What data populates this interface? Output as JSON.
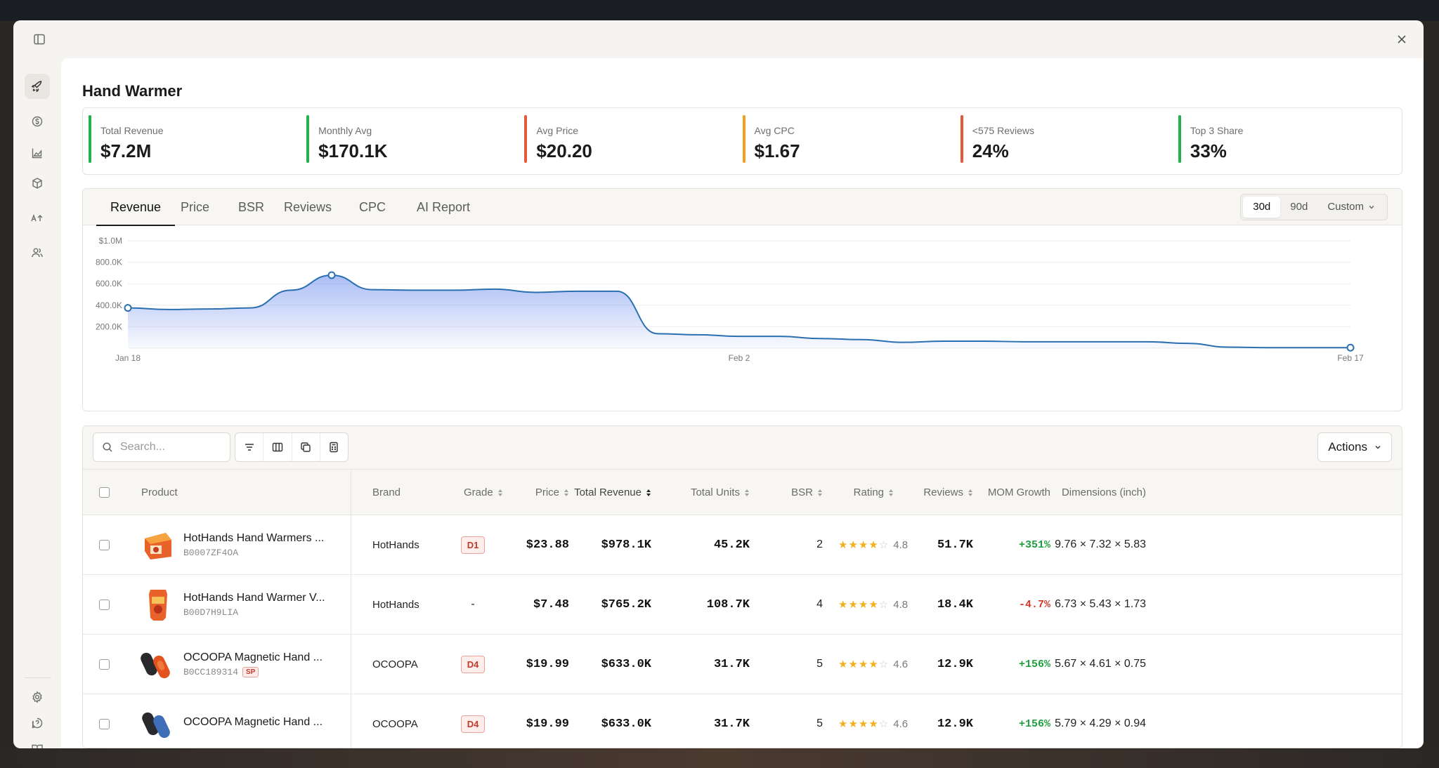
{
  "title": "Hand Warmer",
  "kpis": [
    {
      "label": "Total Revenue",
      "value": "$7.2M",
      "color": "#22b14c"
    },
    {
      "label": "Monthly Avg",
      "value": "$170.1K",
      "color": "#22b14c"
    },
    {
      "label": "Avg Price",
      "value": "$20.20",
      "color": "#e35a3a"
    },
    {
      "label": "Avg CPC",
      "value": "$1.67",
      "color": "#f0a020"
    },
    {
      "label": "<575 Reviews",
      "value": "24%",
      "color": "#e35a3a"
    },
    {
      "label": "Top 3 Share",
      "value": "33%",
      "color": "#22b14c"
    }
  ],
  "tabs": [
    "Revenue",
    "Price",
    "BSR",
    "Reviews",
    "CPC",
    "AI Report"
  ],
  "ranges": {
    "r30": "30d",
    "r90": "90d",
    "custom": "Custom"
  },
  "chart_data": {
    "type": "area",
    "x": [
      "Jan 18",
      "Jan 19",
      "Jan 20",
      "Jan 21",
      "Jan 22",
      "Jan 23",
      "Jan 24",
      "Jan 25",
      "Jan 26",
      "Jan 27",
      "Jan 28",
      "Jan 29",
      "Jan 30",
      "Jan 31",
      "Feb 1",
      "Feb 2",
      "Feb 3",
      "Feb 4",
      "Feb 5",
      "Feb 6",
      "Feb 7",
      "Feb 8",
      "Feb 9",
      "Feb 10",
      "Feb 11",
      "Feb 12",
      "Feb 13",
      "Feb 14",
      "Feb 15",
      "Feb 16",
      "Feb 17"
    ],
    "y": [
      375000,
      360000,
      365000,
      375000,
      540000,
      680000,
      545000,
      540000,
      540000,
      550000,
      520000,
      530000,
      530000,
      135000,
      125000,
      110000,
      110000,
      90000,
      80000,
      55000,
      65000,
      65000,
      60000,
      60000,
      60000,
      60000,
      45000,
      10000,
      5000,
      5000,
      5000
    ],
    "y_ticks": [
      "$1.0M",
      "800.0K",
      "600.0K",
      "400.0K",
      "200.0K"
    ],
    "y_tick_values": [
      1000000,
      800000,
      600000,
      400000,
      200000
    ],
    "x_tick_labels": [
      "Jan 18",
      "Feb 2",
      "Feb 17"
    ],
    "x_tick_index": [
      0,
      15,
      30
    ],
    "markers": [
      0,
      5,
      30
    ],
    "ylim": [
      0,
      1000000
    ],
    "line_color": "#2a6fb0",
    "fill_color": "#7e9bf0",
    "grid": true
  },
  "table": {
    "search_placeholder": "Search...",
    "actions_label": "Actions",
    "headers": {
      "product": "Product",
      "brand": "Brand",
      "grade": "Grade",
      "price": "Price",
      "revenue": "Total Revenue",
      "units": "Total Units",
      "bsr": "BSR",
      "rating": "Rating",
      "reviews": "Reviews",
      "mom": "MOM Growth",
      "dims": "Dimensions (inch)"
    },
    "rows": [
      {
        "name": "HotHands Hand Warmers ...",
        "asin": "B0007ZF4OA",
        "sp": "",
        "brand": "HotHands",
        "grade": "D1",
        "price": "$23.88",
        "revenue": "$978.1K",
        "units": "45.2K",
        "bsr": "2",
        "rating": "4.8",
        "stars": 4,
        "reviews": "51.7K",
        "mom": "+351%",
        "dims": "9.76 × 7.32 × 5.83"
      },
      {
        "name": "HotHands Hand Warmer V...",
        "asin": "B00D7H9LIA",
        "sp": "",
        "brand": "HotHands",
        "grade": "-",
        "price": "$7.48",
        "revenue": "$765.2K",
        "units": "108.7K",
        "bsr": "4",
        "rating": "4.8",
        "stars": 4,
        "reviews": "18.4K",
        "mom": "-4.7%",
        "dims": "6.73 × 5.43 × 1.73"
      },
      {
        "name": "OCOOPA Magnetic Hand ...",
        "asin": "B0CC189314",
        "sp": "SP",
        "brand": "OCOOPA",
        "grade": "D4",
        "price": "$19.99",
        "revenue": "$633.0K",
        "units": "31.7K",
        "bsr": "5",
        "rating": "4.6",
        "stars": 4,
        "reviews": "12.9K",
        "mom": "+156%",
        "dims": "5.67 × 4.61 × 0.75"
      },
      {
        "name": "OCOOPA Magnetic Hand ...",
        "asin": "",
        "sp": "",
        "brand": "OCOOPA",
        "grade": "D4",
        "price": "$19.99",
        "revenue": "$633.0K",
        "units": "31.7K",
        "bsr": "5",
        "rating": "4.6",
        "stars": 4,
        "reviews": "12.9K",
        "mom": "+156%",
        "dims": "5.79 × 4.29 × 0.94"
      }
    ]
  }
}
